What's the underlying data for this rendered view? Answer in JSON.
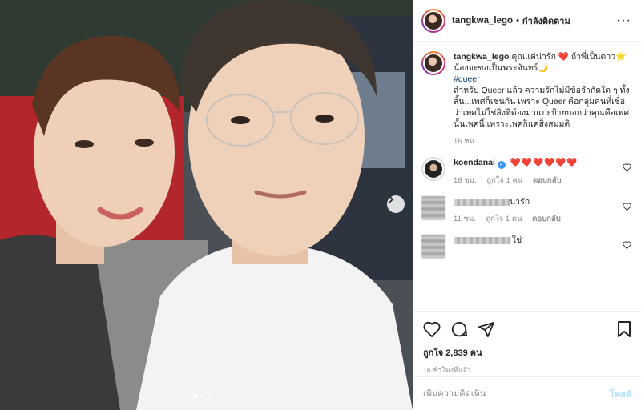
{
  "header": {
    "username": "tangkwa_lego",
    "separator": "•",
    "follow_label": "กำลังติดตาม",
    "more_icon": "more-options-icon"
  },
  "caption": {
    "username": "tangkwa_lego",
    "line1": "คุณแค่น่ารัก ❤️ ถ้าพี่เป็นดาว⭐ น้องจะขอเป็นพระจันทร์🌙",
    "hashtag": "#queer",
    "line2": "สำหรับ Queer แล้ว ความรักไม่มีข้อจำกัดใด ๆ ทั้งสิ้น...เพศก็เช่นกัน เพราะ Queer คือกลุ่มคนที่เชื่อว่าเพศไม่ใช่สิ่งที่ต้องมาแปะป้ายบอกว่าคุณคือเพศนั้นเพศนี้ เพราะเพศก็แค่สิ่งสมมติ",
    "time": "16 ชม."
  },
  "comments": [
    {
      "username": "koendanai",
      "verified": true,
      "text": "❤️❤️❤️❤️❤️❤️",
      "time": "16 ชม.",
      "likes": "ถูกใจ 1 คน",
      "reply": "ตอบกลับ"
    },
    {
      "username_hidden": true,
      "text": "น่ารัก",
      "time": "11 ชม.",
      "likes": "ถูกใจ 1 คน",
      "reply": "ตอบกลับ"
    },
    {
      "username_hidden": true,
      "text": "ใช่"
    }
  ],
  "actions": {
    "like_icon": "heart-icon",
    "comment_icon": "comment-icon",
    "share_icon": "share-icon",
    "save_icon": "bookmark-icon",
    "likes_text": "ถูกใจ 2,839 คน",
    "timestamp": "16 ชั่วโมงที่แล้ว"
  },
  "add_comment": {
    "placeholder": "เพิ่มความคิดเห็น",
    "post_label": "โพสต์"
  },
  "carousel": {
    "total_slides": 3,
    "active_slide": 1,
    "next_icon": "chevron-right-icon"
  },
  "colors": {
    "link_blue": "#00376b",
    "heart_red": "#ed4956",
    "verified_blue": "#3897f0",
    "post_disabled": "#b2dffc"
  }
}
